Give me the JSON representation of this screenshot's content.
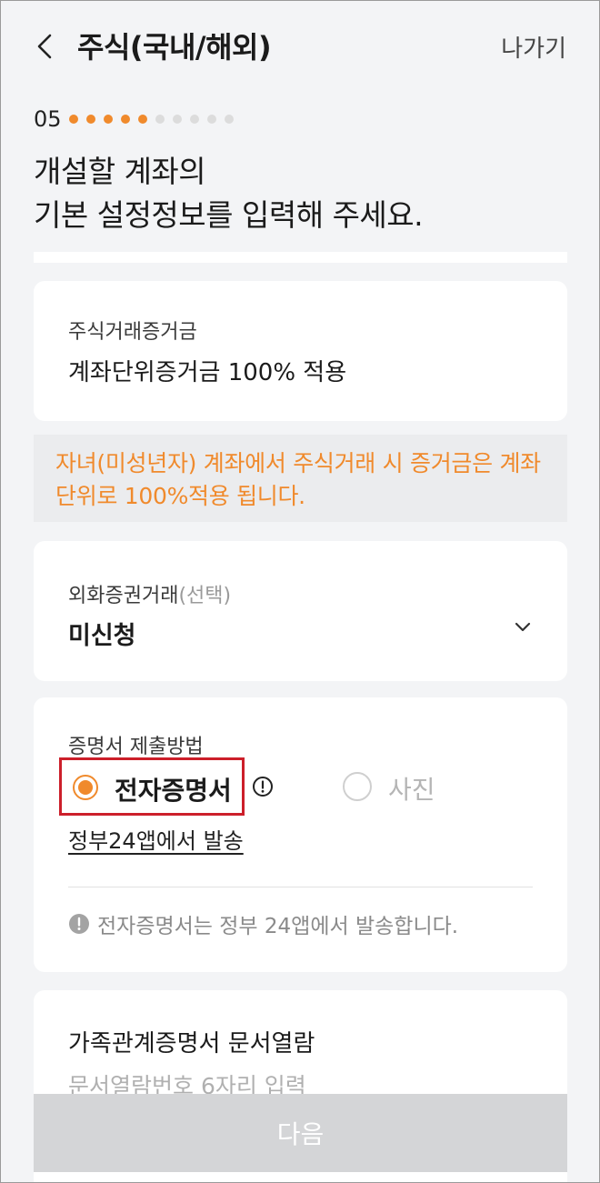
{
  "header": {
    "title": "주식(국내/해외)",
    "exit_label": "나가기"
  },
  "progress": {
    "step": "05",
    "total_dots": 10,
    "active_dots": 5,
    "active_color": "#f08a2c",
    "inactive_color": "#dcdcdc"
  },
  "headline": {
    "line1": "개설할 계좌의",
    "line2": "기본 설정정보를 입력해 주세요."
  },
  "margin_card": {
    "label": "주식거래증거금",
    "value": "계좌단위증거금 100% 적용"
  },
  "notice": {
    "text": "자녀(미성년자) 계좌에서 주식거래 시 증거금은 계좌단위로 100%적용 됩니다."
  },
  "fx_card": {
    "label": "외화증권거래",
    "label_suffix": "(선택)",
    "value": "미신청"
  },
  "cert_card": {
    "label": "증명서 제출방법",
    "options": [
      {
        "label": "전자증명서",
        "selected": true
      },
      {
        "label": "사진",
        "selected": false
      }
    ],
    "link": "정부24앱에서 발송",
    "hint": "전자증명서는 정부 24앱에서 발송합니다."
  },
  "family_card": {
    "label": "가족관계증명서 문서열람",
    "placeholder": "문서열람번호 6자리 입력"
  },
  "next_button": {
    "label": "다음"
  }
}
